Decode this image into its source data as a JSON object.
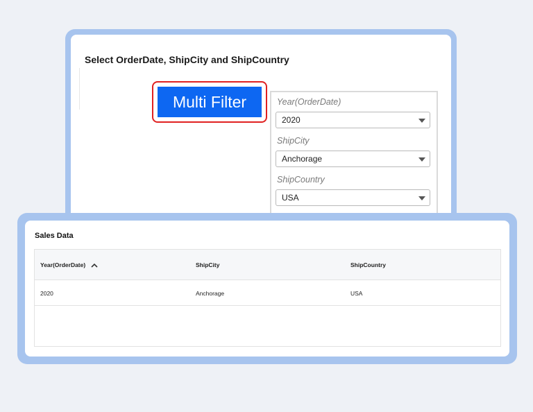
{
  "filter_widget": {
    "title": "Select OrderDate, ShipCity and ShipCountry",
    "multi_filter_label": "Multi Filter",
    "filters": [
      {
        "label": "Year(OrderDate)",
        "value": "2020"
      },
      {
        "label": "ShipCity",
        "value": "Anchorage"
      },
      {
        "label": "ShipCountry",
        "value": "USA"
      }
    ]
  },
  "sales_grid": {
    "title": "Sales Data",
    "columns": [
      "Year(OrderDate)",
      "ShipCity",
      "ShipCountry"
    ],
    "rows": [
      [
        "2020",
        "Anchorage",
        "USA"
      ]
    ],
    "sort_icon": "chevron-up-icon"
  },
  "colors": {
    "button_blue": "#0d67f2",
    "highlight_red": "#e02020",
    "frame_blue": "#a7c4ee"
  }
}
